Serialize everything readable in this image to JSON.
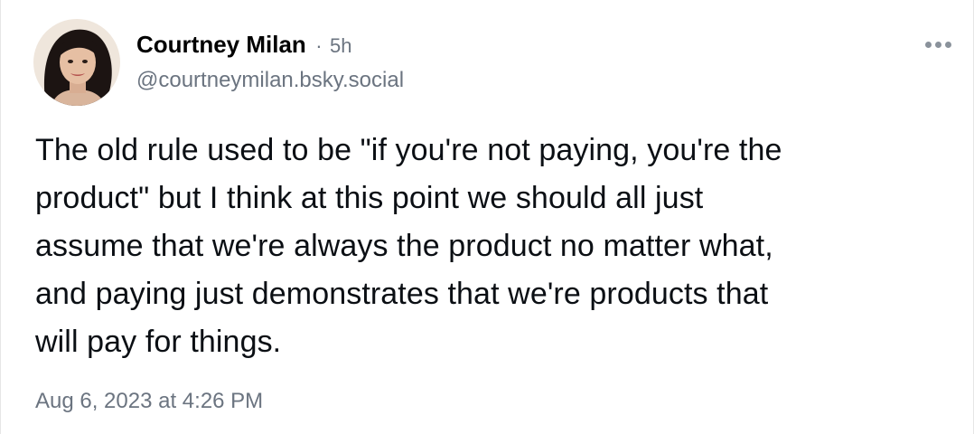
{
  "author": {
    "display_name": "Courtney Milan",
    "handle": "@courtneymilan.bsky.social",
    "separator": "·",
    "time_ago": "5h"
  },
  "post": {
    "text_lines": [
      "The old rule used to be \"if you're not paying, you're the",
      "product\" but I think at this point we should all just",
      "assume that we're always the product no matter what,",
      "and paying just demonstrates that we're products that",
      "will pay for things."
    ],
    "timestamp": "Aug 6, 2023 at 4:26 PM"
  },
  "icons": {
    "more": "more-horizontal-icon",
    "avatar": "profile-photo"
  },
  "colors": {
    "text": "#0b0f14",
    "muted": "#6b7480",
    "icon": "#8a929b"
  }
}
